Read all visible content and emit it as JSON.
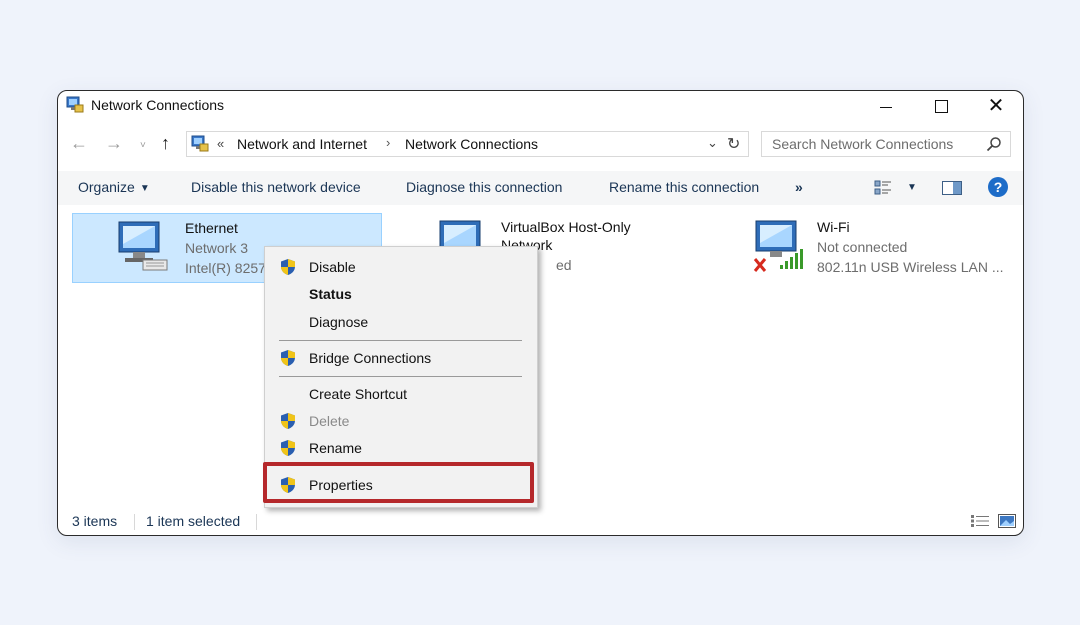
{
  "window": {
    "title": "Network Connections",
    "controls": {
      "minimize": "—",
      "maximize": "☐",
      "close": "✕"
    }
  },
  "address": {
    "back": "←",
    "forward": "→",
    "recent": "˅",
    "up": "↑",
    "chevron": "«",
    "breadcrumbs": [
      "Network and Internet",
      "Network Connections"
    ],
    "separator": "›",
    "dropdown": "⌄",
    "refresh": "↻"
  },
  "search": {
    "placeholder": "Search Network Connections"
  },
  "commands": {
    "organize": "Organize",
    "disable": "Disable this network device",
    "diagnose": "Diagnose this connection",
    "rename": "Rename this connection",
    "more": "»",
    "help": "?"
  },
  "connections": [
    {
      "name": "Ethernet",
      "status": "Network 3",
      "device": "Intel(R) 8257"
    },
    {
      "name": "VirtualBox Host-Only",
      "status": "Network",
      "device": "ed"
    },
    {
      "name": "Wi-Fi",
      "status": "Not connected",
      "device": "802.11n USB Wireless LAN ..."
    }
  ],
  "context_menu": {
    "items": [
      {
        "label": "Disable",
        "shield": true
      },
      {
        "label": "Status",
        "bold": true
      },
      {
        "label": "Diagnose"
      },
      {
        "label": "Bridge Connections",
        "shield": true
      },
      {
        "label": "Create Shortcut"
      },
      {
        "label": "Delete",
        "shield": true,
        "disabled": true
      },
      {
        "label": "Rename",
        "shield": true
      },
      {
        "label": "Properties",
        "shield": true,
        "highlighted": true
      }
    ]
  },
  "statusbar": {
    "count": "3 items",
    "selected": "1 item selected"
  },
  "colors": {
    "background": "#eff3fb",
    "selection": "#cce8ff",
    "highlight_border": "#b5282b",
    "help": "#1d6cc8"
  }
}
